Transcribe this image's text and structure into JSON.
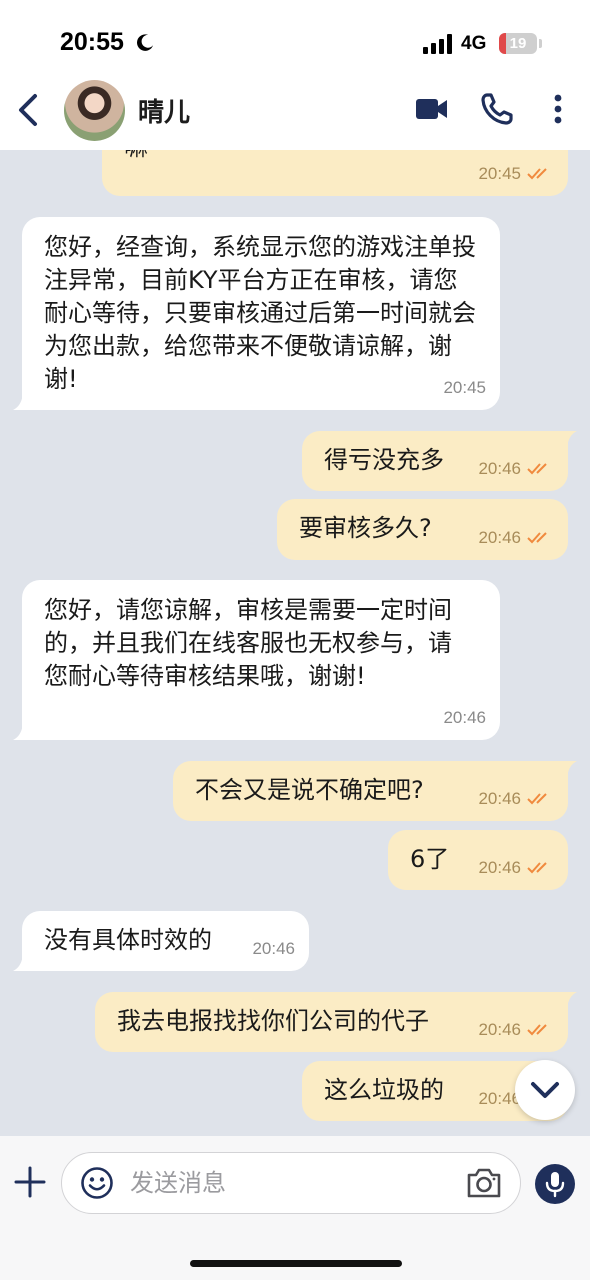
{
  "status_bar": {
    "time": "20:55",
    "network": "4G",
    "battery_level": "19",
    "battery_fraction": 0.19
  },
  "header": {
    "contact_name": "晴儿"
  },
  "colors": {
    "accent": "#1f2f5b",
    "outgoing_bubble": "#fbecc5",
    "incoming_bubble": "#ffffff",
    "chat_background": "#dfe3ea",
    "read_check": "#f08a3e"
  },
  "messages": [
    {
      "direction": "out",
      "text": "嘛",
      "time": "20:45",
      "read": true
    },
    {
      "direction": "in",
      "text": "您好，经查询，系统显示您的游戏注单投注异常，目前KY平台方正在审核，请您耐心等待，只要审核通过后第一时间就会为您出款，给您带来不便敬请谅解，谢谢!",
      "time": "20:45"
    },
    {
      "direction": "out",
      "text": "得亏没充多",
      "time": "20:46",
      "read": true
    },
    {
      "direction": "out",
      "text": "要审核多久?",
      "time": "20:46",
      "read": true
    },
    {
      "direction": "in",
      "text": "您好，请您谅解，审核是需要一定时间的，并且我们在线客服也无权参与，请您耐心等待审核结果哦，谢谢!",
      "time": "20:46"
    },
    {
      "direction": "out",
      "text": "不会又是说不确定吧?",
      "time": "20:46",
      "read": true
    },
    {
      "direction": "out",
      "text": "6了",
      "time": "20:46",
      "read": true
    },
    {
      "direction": "in",
      "text": "没有具体时效的",
      "time": "20:46"
    },
    {
      "direction": "out",
      "text": "我去电报找找你们公司的代子",
      "time": "20:46",
      "read": true
    },
    {
      "direction": "out",
      "text": "这么垃圾的",
      "time": "20:46",
      "read": true
    }
  ],
  "composer": {
    "placeholder": "发送消息"
  },
  "icons": {
    "back": "chevron-left-icon",
    "video": "video-camera-icon",
    "call": "phone-icon",
    "more": "more-vertical-icon",
    "attach": "plus-icon",
    "emoji": "smiley-icon",
    "camera": "camera-icon",
    "mic": "microphone-icon",
    "scroll": "chevron-down-icon",
    "read": "double-check-icon"
  }
}
